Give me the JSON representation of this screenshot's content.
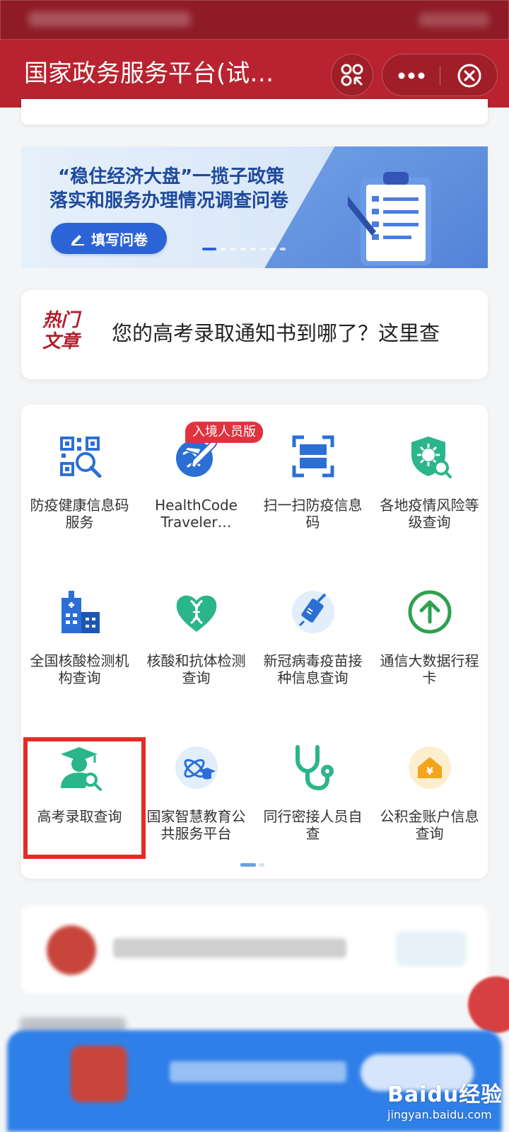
{
  "header": {
    "title": "国家政务服务平台(试…",
    "scan_icon": "mini-program-code-icon",
    "more_icon": "ellipsis-icon",
    "close_icon": "close-circle-icon",
    "bg_color": "#b8232f"
  },
  "banner": {
    "line1": "“稳住经济大盘”一揽子政策",
    "line2": "落实和服务办理情况调查问卷",
    "button_label": "填写问卷"
  },
  "hot_article": {
    "tag": "热门文章",
    "tag_line1": "热门",
    "tag_line2": "文章",
    "title": "您的高考录取通知书到哪了？这里查"
  },
  "services": {
    "badge": "入境人员版",
    "items": [
      {
        "label": "防疫健康信息码服务",
        "icon": "health-code-scan-icon"
      },
      {
        "label": "HealthCode Traveler…",
        "icon": "airplane-globe-icon"
      },
      {
        "label": "扫一扫防疫信息码",
        "icon": "scan-frame-icon"
      },
      {
        "label": "各地疫情风险等级查询",
        "icon": "virus-shield-icon"
      },
      {
        "label": "全国核酸检测机构查询",
        "icon": "hospital-building-icon"
      },
      {
        "label": "核酸和抗体检测查询",
        "icon": "dna-heart-icon"
      },
      {
        "label": "新冠病毒疫苗接种信息查询",
        "icon": "vaccine-icon"
      },
      {
        "label": "通信大数据行程卡",
        "icon": "arrow-up-circle-icon"
      },
      {
        "label": "高考录取查询",
        "icon": "graduate-search-icon"
      },
      {
        "label": "国家智慧教育公共服务平台",
        "icon": "atom-graduation-icon"
      },
      {
        "label": "同行密接人员自查",
        "icon": "stethoscope-icon"
      },
      {
        "label": "公积金账户信息查询",
        "icon": "house-yuan-icon"
      }
    ]
  },
  "watermark": {
    "brand": "Baidu经验",
    "site": "jingyan.baidu.com"
  }
}
